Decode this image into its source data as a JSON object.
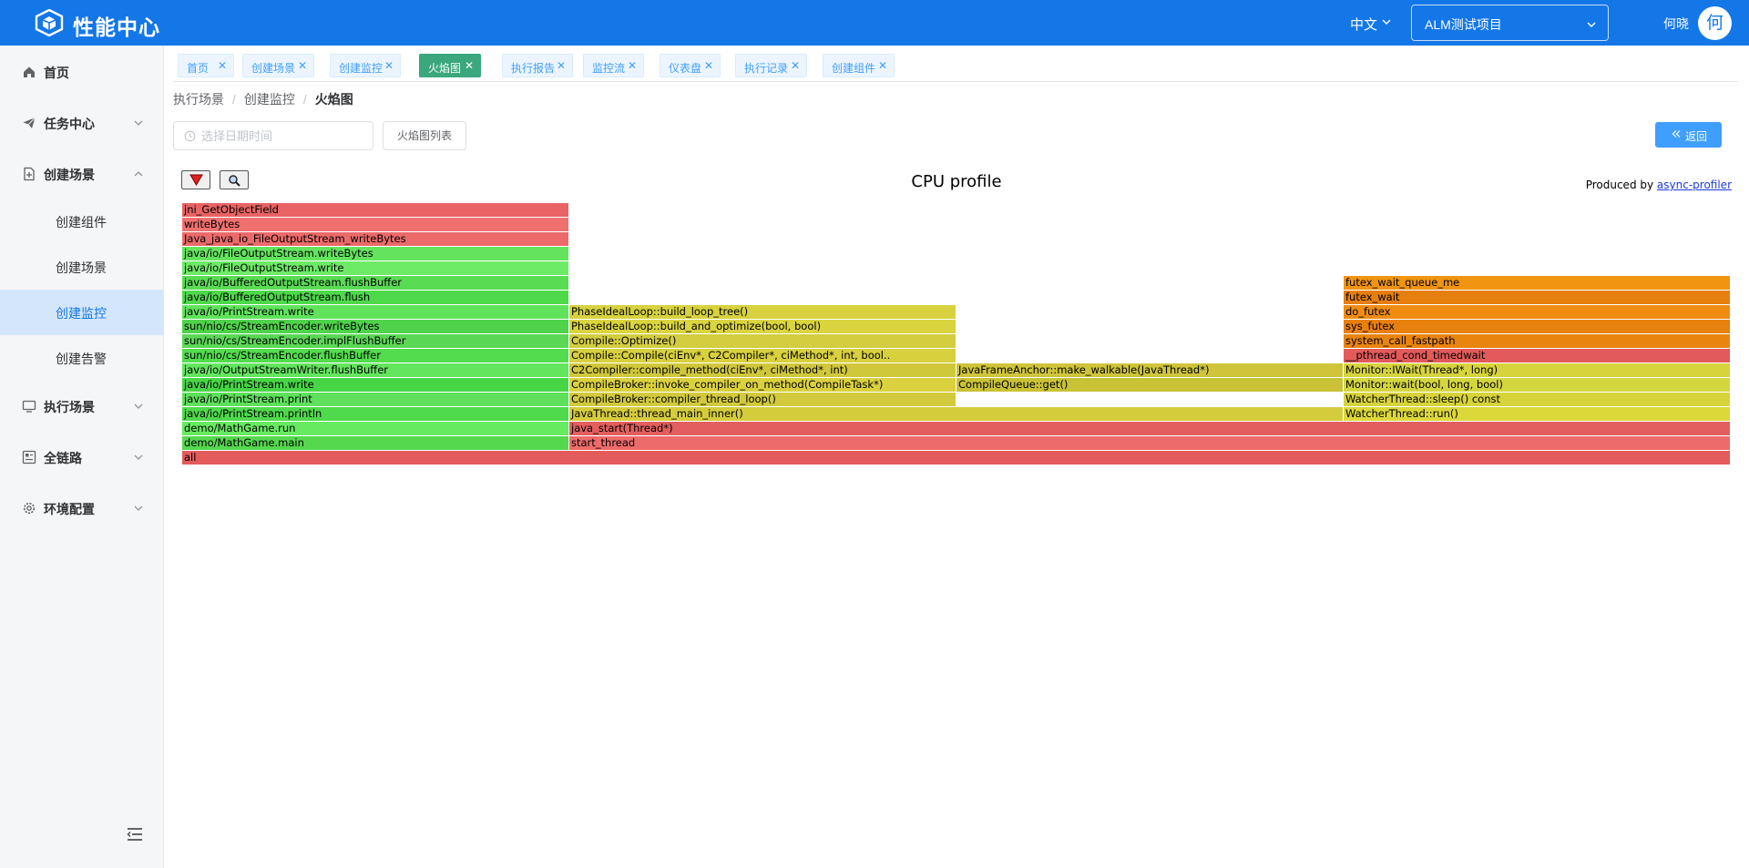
{
  "app": {
    "title": "性能中心",
    "logo_icon": "cube-logo-icon"
  },
  "header": {
    "language": "中文",
    "project": "ALM测试项目",
    "username": "何晓",
    "avatar_text": "何",
    "brand_color": "#1477e8"
  },
  "sidebar": {
    "menu": [
      {
        "label": "首页",
        "icon": "home-icon"
      },
      {
        "label": "任务中心",
        "icon": "send-icon"
      },
      {
        "label": "创建场景",
        "icon": "file-add-icon"
      },
      {
        "label": "执行场景",
        "icon": "monitor-icon"
      },
      {
        "label": "全链路",
        "icon": "dashboard-icon"
      },
      {
        "label": "环境配置",
        "icon": "gear-icon"
      }
    ],
    "submenu": [
      {
        "label": "创建组件"
      },
      {
        "label": "创建场景"
      },
      {
        "label": "创建监控",
        "active": true
      },
      {
        "label": "创建告警"
      }
    ]
  },
  "tabs": [
    {
      "label": "首页"
    },
    {
      "label": "创建场景"
    },
    {
      "label": "创建监控"
    },
    {
      "label": "火焰图",
      "active": true
    },
    {
      "label": "执行报告"
    },
    {
      "label": "监控流"
    },
    {
      "label": "仪表盘"
    },
    {
      "label": "执行记录"
    },
    {
      "label": "创建组件"
    }
  ],
  "breadcrumb": {
    "items": [
      "执行场景",
      "创建监控"
    ],
    "current": "火焰图"
  },
  "toolbar": {
    "date_placeholder": "选择日期时间",
    "list_button": "火焰图列表",
    "back_button": "返回"
  },
  "flamegraph": {
    "title": "CPU profile",
    "produced_by": "Produced by",
    "produced_link": "async-profiler",
    "colors": {
      "java": "#5fe05c",
      "cpp": "#d4cd3a",
      "kernel": "#ee8a0f",
      "native": "#ec6666"
    },
    "frames": [
      {
        "name": "all",
        "row": 0,
        "start": 0,
        "end": 1,
        "color": "#e45b5b"
      },
      {
        "name": "demo/MathGame.main",
        "row": 1,
        "start": 0,
        "end": 0.25,
        "color": "#55d84e"
      },
      {
        "name": "start_thread",
        "row": 1,
        "start": 0.25,
        "end": 1,
        "color": "#ee6b6b"
      },
      {
        "name": "demo/MathGame.run",
        "row": 2,
        "start": 0,
        "end": 0.25,
        "color": "#66ea60"
      },
      {
        "name": "java_start(Thread*)",
        "row": 2,
        "start": 0.25,
        "end": 1,
        "color": "#e35e5e"
      },
      {
        "name": "java/io/PrintStream.println",
        "row": 3,
        "start": 0,
        "end": 0.25,
        "color": "#4fd94c"
      },
      {
        "name": "JavaThread::thread_main_inner()",
        "row": 3,
        "start": 0.25,
        "end": 0.75,
        "color": "#d5cc3c"
      },
      {
        "name": "WatcherThread::run()",
        "row": 3,
        "start": 0.75,
        "end": 1,
        "color": "#dcd83a"
      },
      {
        "name": "java/io/PrintStream.print",
        "row": 4,
        "start": 0,
        "end": 0.25,
        "color": "#5fe05c"
      },
      {
        "name": "CompileBroker::compiler_thread_loop()",
        "row": 4,
        "start": 0.25,
        "end": 0.5,
        "color": "#d2ca3c"
      },
      {
        "name": "WatcherThread::sleep() const",
        "row": 4,
        "start": 0.75,
        "end": 1,
        "color": "#d7d33a"
      },
      {
        "name": "java/io/PrintStream.write",
        "row": 5,
        "start": 0,
        "end": 0.25,
        "color": "#47d546"
      },
      {
        "name": "CompileBroker::invoke_compiler_on_method(CompileTask*)",
        "row": 5,
        "start": 0.25,
        "end": 0.5,
        "color": "#dbd13e"
      },
      {
        "name": "CompileQueue::get()",
        "row": 5,
        "start": 0.5,
        "end": 0.75,
        "color": "#c9c237"
      },
      {
        "name": "Monitor::wait(bool, long, bool)",
        "row": 5,
        "start": 0.75,
        "end": 1,
        "color": "#d4d640"
      },
      {
        "name": "java/io/OutputStreamWriter.flushBuffer",
        "row": 6,
        "start": 0,
        "end": 0.25,
        "color": "#63e55e"
      },
      {
        "name": "C2Compiler::compile_method(ciEnv*, ciMethod*, int)",
        "row": 6,
        "start": 0.25,
        "end": 0.5,
        "color": "#d0c83b"
      },
      {
        "name": "JavaFrameAnchor::make_walkable(JavaThread*)",
        "row": 6,
        "start": 0.5,
        "end": 0.75,
        "color": "#cfc43a"
      },
      {
        "name": "Monitor::IWait(Thread*, long)",
        "row": 6,
        "start": 0.75,
        "end": 1,
        "color": "#d6d33d"
      },
      {
        "name": "sun/nio/cs/StreamEncoder.flushBuffer",
        "row": 7,
        "start": 0,
        "end": 0.25,
        "color": "#53dc4e"
      },
      {
        "name": "Compile::Compile(ciEnv*, C2Compiler*, ciMethod*, int, bool..",
        "row": 7,
        "start": 0.25,
        "end": 0.5,
        "color": "#d8d03d"
      },
      {
        "name": "__pthread_cond_timedwait",
        "row": 7,
        "start": 0.75,
        "end": 1,
        "color": "#e35a5a"
      },
      {
        "name": "sun/nio/cs/StreamEncoder.implFlushBuffer",
        "row": 8,
        "start": 0,
        "end": 0.25,
        "color": "#5ad855"
      },
      {
        "name": "Compile::Optimize()",
        "row": 8,
        "start": 0.25,
        "end": 0.5,
        "color": "#d3cd3f"
      },
      {
        "name": "system_call_fastpath",
        "row": 8,
        "start": 0.75,
        "end": 1,
        "color": "#e9850f"
      },
      {
        "name": "sun/nio/cs/StreamEncoder.writeBytes",
        "row": 9,
        "start": 0,
        "end": 0.25,
        "color": "#4fd34b"
      },
      {
        "name": "PhaseIdealLoop::build_and_optimize(bool, bool)",
        "row": 9,
        "start": 0.25,
        "end": 0.5,
        "color": "#dad43f"
      },
      {
        "name": "sys_futex",
        "row": 9,
        "start": 0.75,
        "end": 1,
        "color": "#e8800d"
      },
      {
        "name": "java/io/PrintStream.write",
        "row": 10,
        "start": 0,
        "end": 0.25,
        "color": "#60e35b"
      },
      {
        "name": "PhaseIdealLoop::build_loop_tree()",
        "row": 10,
        "start": 0.25,
        "end": 0.5,
        "color": "#d7d23e"
      },
      {
        "name": "do_futex",
        "row": 10,
        "start": 0.75,
        "end": 1,
        "color": "#f08c12"
      },
      {
        "name": "java/io/BufferedOutputStream.flush",
        "row": 11,
        "start": 0,
        "end": 0.25,
        "color": "#4dd949"
      },
      {
        "name": "futex_wait",
        "row": 11,
        "start": 0.75,
        "end": 1,
        "color": "#e67f0e"
      },
      {
        "name": "java/io/BufferedOutputStream.flushBuffer",
        "row": 12,
        "start": 0,
        "end": 0.25,
        "color": "#5adb54"
      },
      {
        "name": "futex_wait_queue_me",
        "row": 12,
        "start": 0.75,
        "end": 1,
        "color": "#f09412"
      },
      {
        "name": "java/io/FileOutputStream.write",
        "row": 13,
        "start": 0,
        "end": 0.25,
        "color": "#6deb67"
      },
      {
        "name": "java/io/FileOutputStream.writeBytes",
        "row": 14,
        "start": 0,
        "end": 0.25,
        "color": "#64e45e"
      },
      {
        "name": "Java_java_io_FileOutputStream_writeBytes",
        "row": 15,
        "start": 0,
        "end": 0.25,
        "color": "#ec6a6a"
      },
      {
        "name": "writeBytes",
        "row": 16,
        "start": 0,
        "end": 0.25,
        "color": "#f07070"
      },
      {
        "name": "jni_GetObjectField",
        "row": 17,
        "start": 0,
        "end": 0.25,
        "color": "#e86363"
      }
    ]
  }
}
